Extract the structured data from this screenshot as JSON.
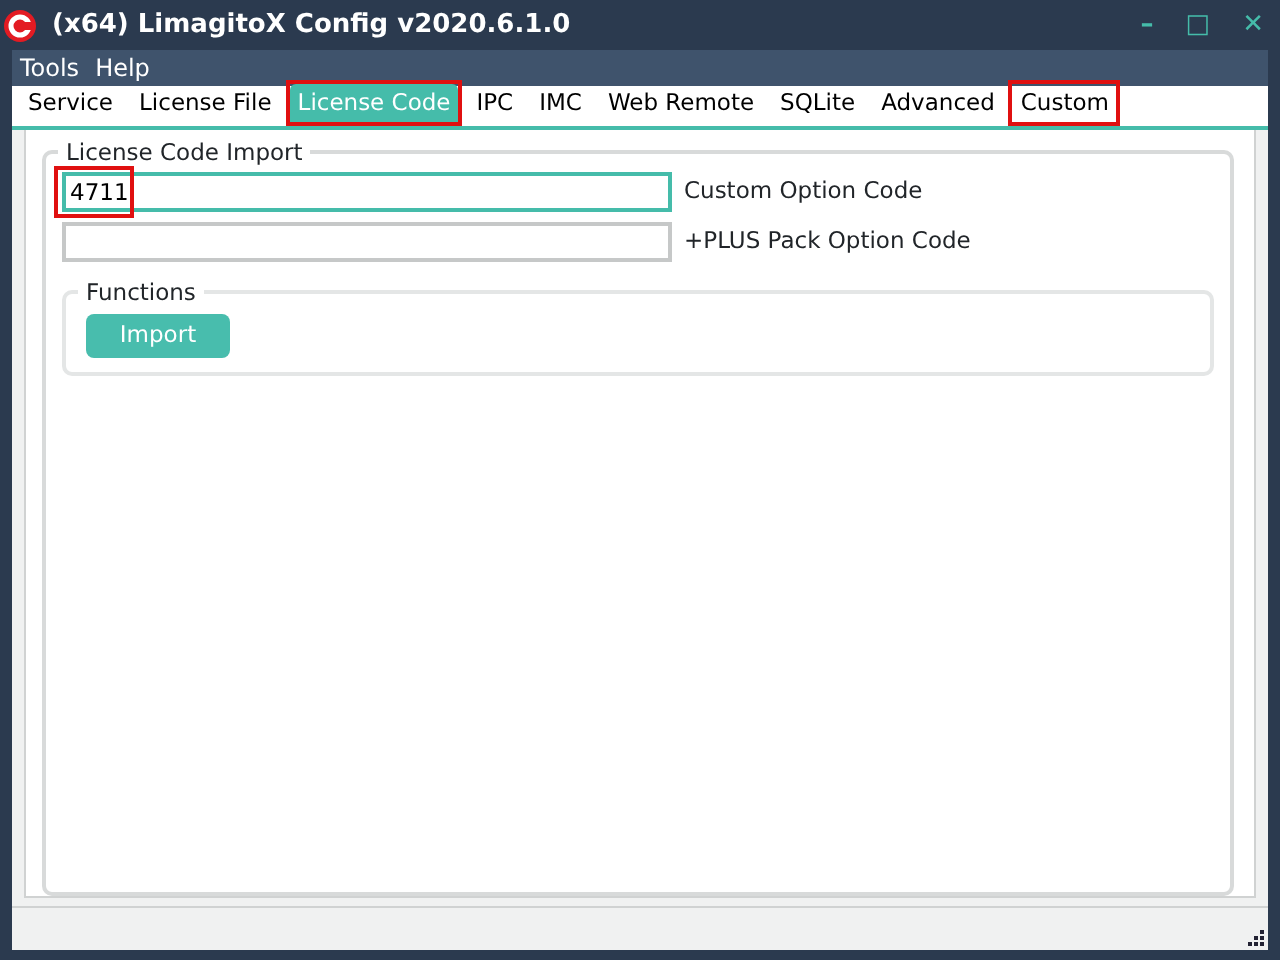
{
  "window": {
    "title": "(x64) LimagitoX Config v2020.6.1.0",
    "controls": [
      "–",
      "□",
      "✕"
    ]
  },
  "menu": [
    "Tools",
    "Help"
  ],
  "tabs": [
    {
      "label": "Service",
      "selected": false,
      "highlighted": false
    },
    {
      "label": "License File",
      "selected": false,
      "highlighted": false
    },
    {
      "label": "License Code",
      "selected": true,
      "highlighted": true
    },
    {
      "label": "IPC",
      "selected": false,
      "highlighted": false
    },
    {
      "label": "IMC",
      "selected": false,
      "highlighted": false
    },
    {
      "label": "Web Remote",
      "selected": false,
      "highlighted": false
    },
    {
      "label": "SQLite",
      "selected": false,
      "highlighted": false
    },
    {
      "label": "Advanced",
      "selected": false,
      "highlighted": false
    },
    {
      "label": "Custom",
      "selected": false,
      "highlighted": true
    }
  ],
  "group": {
    "title": "License Code Import",
    "fields": [
      {
        "value": "4711",
        "label": "Custom Option Code",
        "focused": true,
        "highlighted": true
      },
      {
        "label": "+PLUS Pack Option Code",
        "focused": false,
        "highlighted": false
      }
    ],
    "functions": {
      "title": "Functions",
      "button": "Import"
    }
  }
}
